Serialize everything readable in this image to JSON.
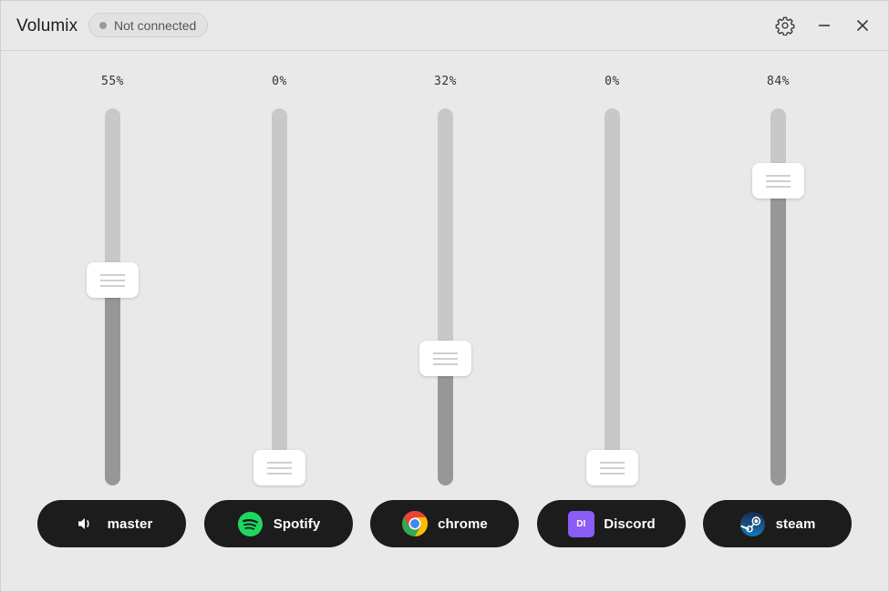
{
  "app": {
    "title": "Volumix",
    "status": "Not connected"
  },
  "titlebar": {
    "settings_icon": "gear-icon",
    "minimize_icon": "minimize-icon",
    "close_icon": "close-icon"
  },
  "colors": {
    "background": "#e9e9e9",
    "track": "#c8c8c8",
    "track_fill": "#979797",
    "button_bg": "#1c1c1c",
    "discord_badge": "#8b5cf6",
    "spotify_green": "#1ed760"
  },
  "channels": [
    {
      "label": "master",
      "percent_text": "55%",
      "level": 0.55,
      "icon": "speaker-icon"
    },
    {
      "label": "Spotify",
      "percent_text": "0%",
      "level": 0.0,
      "icon": "spotify-icon"
    },
    {
      "label": "chrome",
      "percent_text": "32%",
      "level": 0.32,
      "icon": "chrome-icon"
    },
    {
      "label": "Discord",
      "percent_text": "0%",
      "level": 0.0,
      "icon": "discord-icon",
      "badge_text": "DI"
    },
    {
      "label": "steam",
      "percent_text": "84%",
      "level": 0.84,
      "icon": "steam-icon"
    }
  ]
}
